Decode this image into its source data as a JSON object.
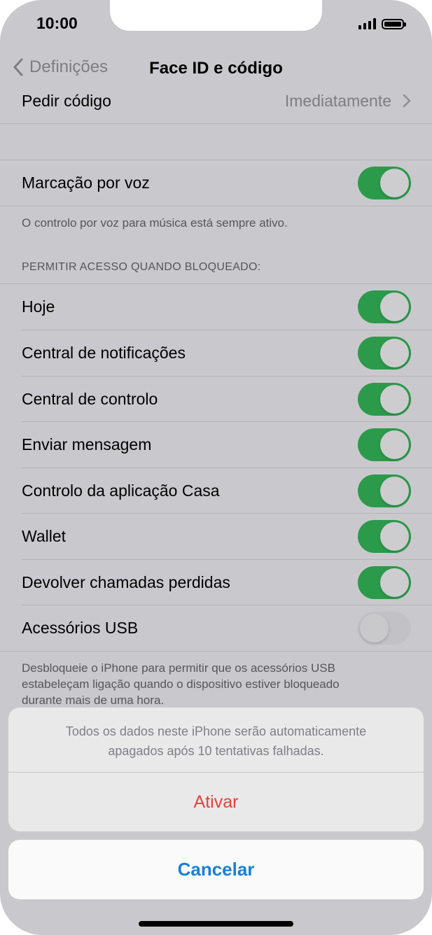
{
  "status_bar": {
    "time": "10:00"
  },
  "nav": {
    "back_label": "Definições",
    "title": "Face ID e código"
  },
  "passcode_row": {
    "label": "Pedir código",
    "value": "Imediatamente"
  },
  "voice_dial": {
    "label": "Marcação por voz",
    "on": true
  },
  "voice_note": "O controlo por voz para música está sempre ativo.",
  "locked_header": "PERMITIR ACESSO QUANDO BLOQUEADO:",
  "locked_items": [
    {
      "label": "Hoje",
      "on": true
    },
    {
      "label": "Central de notificações",
      "on": true
    },
    {
      "label": "Central de controlo",
      "on": true
    },
    {
      "label": "Enviar mensagem",
      "on": true
    },
    {
      "label": "Controlo da aplicação Casa",
      "on": true
    },
    {
      "label": "Wallet",
      "on": true
    },
    {
      "label": "Devolver chamadas perdidas",
      "on": true
    },
    {
      "label": "Acessórios USB",
      "on": false
    }
  ],
  "usb_note": {
    "line1": "Desbloqueie o iPhone para permitir que os acessórios USB",
    "line2": "estabeleçam ligação quando o dispositivo estiver bloqueado",
    "line3": "durante mais de uma hora."
  },
  "action_sheet": {
    "message_line1": "Todos os dados neste iPhone serão automaticamente",
    "message_line2": "apagados após 10 tentativas falhadas.",
    "action_label": "Ativar",
    "cancel_label": "Cancelar"
  },
  "colors": {
    "toggle_on": "#2c9a4b",
    "destructive": "#e0433b",
    "link_blue": "#1a80d6"
  }
}
